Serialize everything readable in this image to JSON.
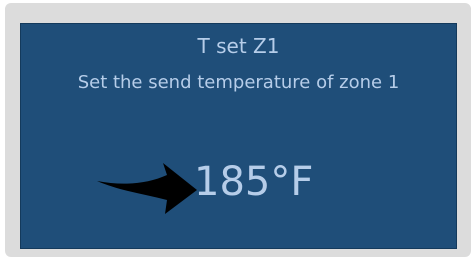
{
  "screen": {
    "title": "T set Z1",
    "description": "Set the send temperature of zone 1",
    "value": "185°F",
    "colors": {
      "background": "#1f4e79",
      "text": "#b6cde9",
      "bezel": "#dcdcdc",
      "arrow": "#000000"
    }
  },
  "icons": {
    "pointer": "black-arrow-icon"
  }
}
